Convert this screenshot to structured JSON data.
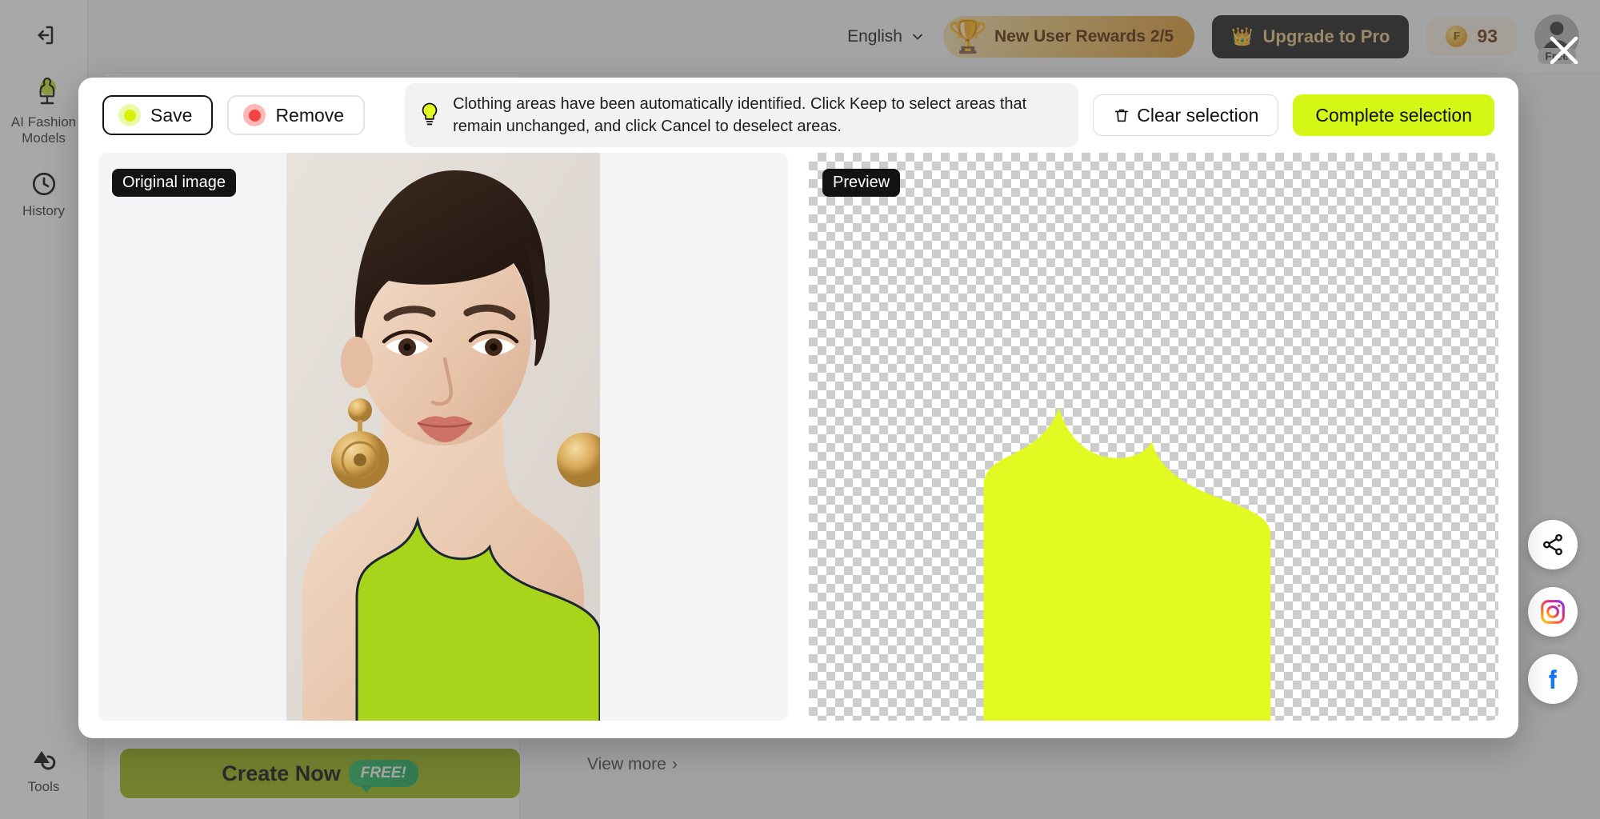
{
  "sidebar": {
    "collapse_icon": "collapse-sidebar-icon",
    "items": [
      {
        "label": "AI Fashion Models",
        "icon": "mannequin-icon"
      },
      {
        "label": "History",
        "icon": "clock-icon"
      }
    ],
    "bottom_item": {
      "label": "Tools",
      "icon": "tools-icon"
    }
  },
  "header": {
    "language": "English",
    "rewards_label": "New User Rewards 2/5",
    "rewards_icon": "trophy-icon",
    "upgrade_label": "Upgrade to Pro",
    "upgrade_icon": "crown-icon",
    "credits": "93",
    "credits_icon": "coin-icon",
    "account_tier": "Free"
  },
  "background": {
    "create_now_label": "Create Now",
    "free_badge": "FREE!",
    "view_more_label": "View more",
    "view_more_chevron": "›"
  },
  "social": [
    {
      "name": "share-icon",
      "label": "Share"
    },
    {
      "name": "instagram-icon",
      "label": "Instagram"
    },
    {
      "name": "facebook-icon",
      "label": "Facebook"
    }
  ],
  "modal": {
    "close_icon": "close-icon",
    "modes": [
      {
        "label": "Save",
        "state": "active",
        "dot_color": "#d7f205",
        "ring_color": "#eaf9a8"
      },
      {
        "label": "Remove",
        "state": "inactive",
        "dot_color": "#f44343",
        "ring_color": "#fdb7b7"
      }
    ],
    "hint_icon": "lightbulb-icon",
    "hint_text": "Clothing areas have been automatically identified. Click Keep to select areas that remain unchanged, and click Cancel to deselect areas.",
    "clear_label": "Clear selection",
    "clear_icon": "trash-icon",
    "complete_label": "Complete selection",
    "original_badge": "Original image",
    "preview_badge": "Preview",
    "mask_color": "#e2fa22",
    "garment_color": "#a8d41c",
    "accent_color": "#d4f716"
  }
}
